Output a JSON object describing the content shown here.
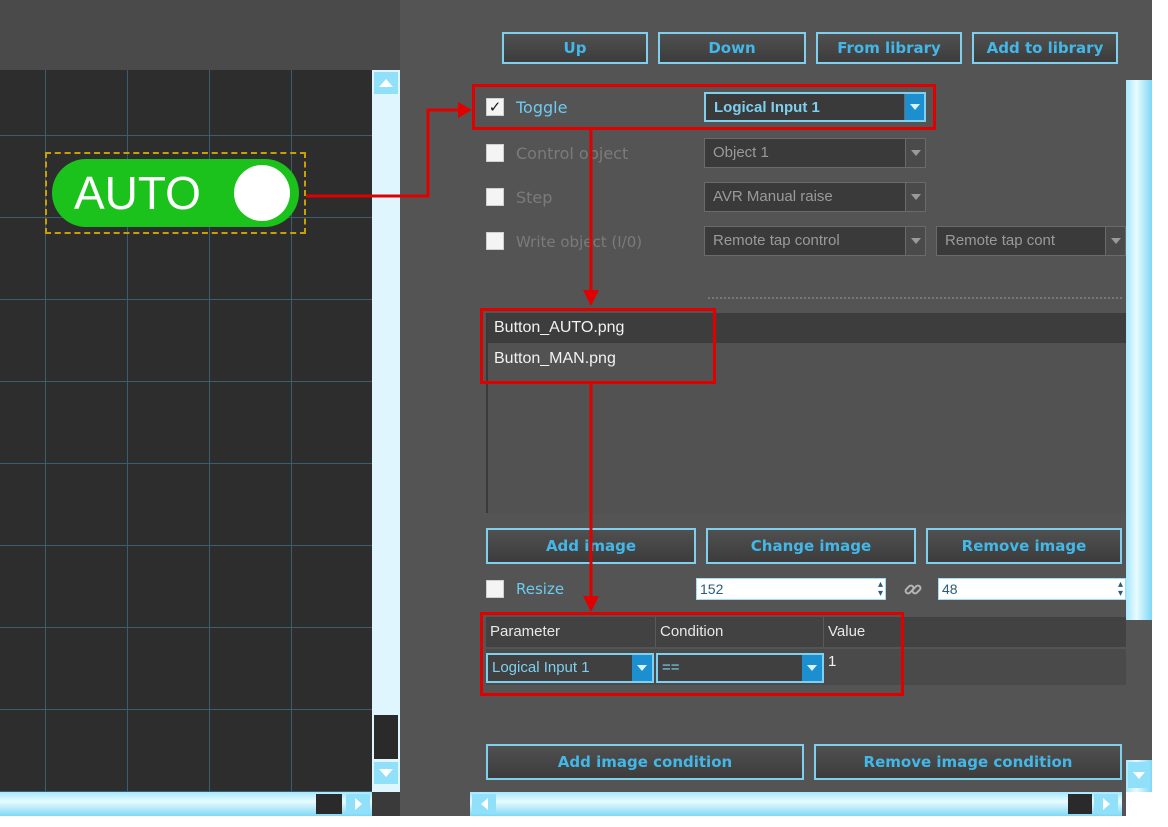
{
  "canvas": {
    "toggle_text": "AUTO"
  },
  "toolbar": {
    "up_label": "Up",
    "down_label": "Down",
    "from_library_label": "From library",
    "add_to_library_label": "Add to library"
  },
  "properties": {
    "toggle": {
      "label": "Toggle",
      "checked": true,
      "value": "Logical Input 1"
    },
    "control_object": {
      "label": "Control object",
      "checked": false,
      "value": "Object 1"
    },
    "step": {
      "label": "Step",
      "checked": false,
      "value": "AVR Manual raise"
    },
    "write_object": {
      "label": "Write object (I/0)",
      "checked": false,
      "value": "Remote tap control",
      "value2": "Remote tap cont"
    }
  },
  "images": {
    "items": [
      "Button_AUTO.png",
      "Button_MAN.png"
    ],
    "add_label": "Add image",
    "change_label": "Change image",
    "remove_label": "Remove image"
  },
  "resize": {
    "label": "Resize",
    "checked": false,
    "width": "152",
    "height": "48"
  },
  "conditions": {
    "headers": [
      "Parameter",
      "Condition",
      "Value"
    ],
    "row": {
      "parameter": "Logical Input 1",
      "condition": "==",
      "value": "1"
    },
    "add_label": "Add image condition",
    "remove_label": "Remove image condition"
  },
  "colors": {
    "accent": "#43b7e8",
    "toggle_green": "#1cc21c",
    "highlight_red": "#e00000"
  }
}
